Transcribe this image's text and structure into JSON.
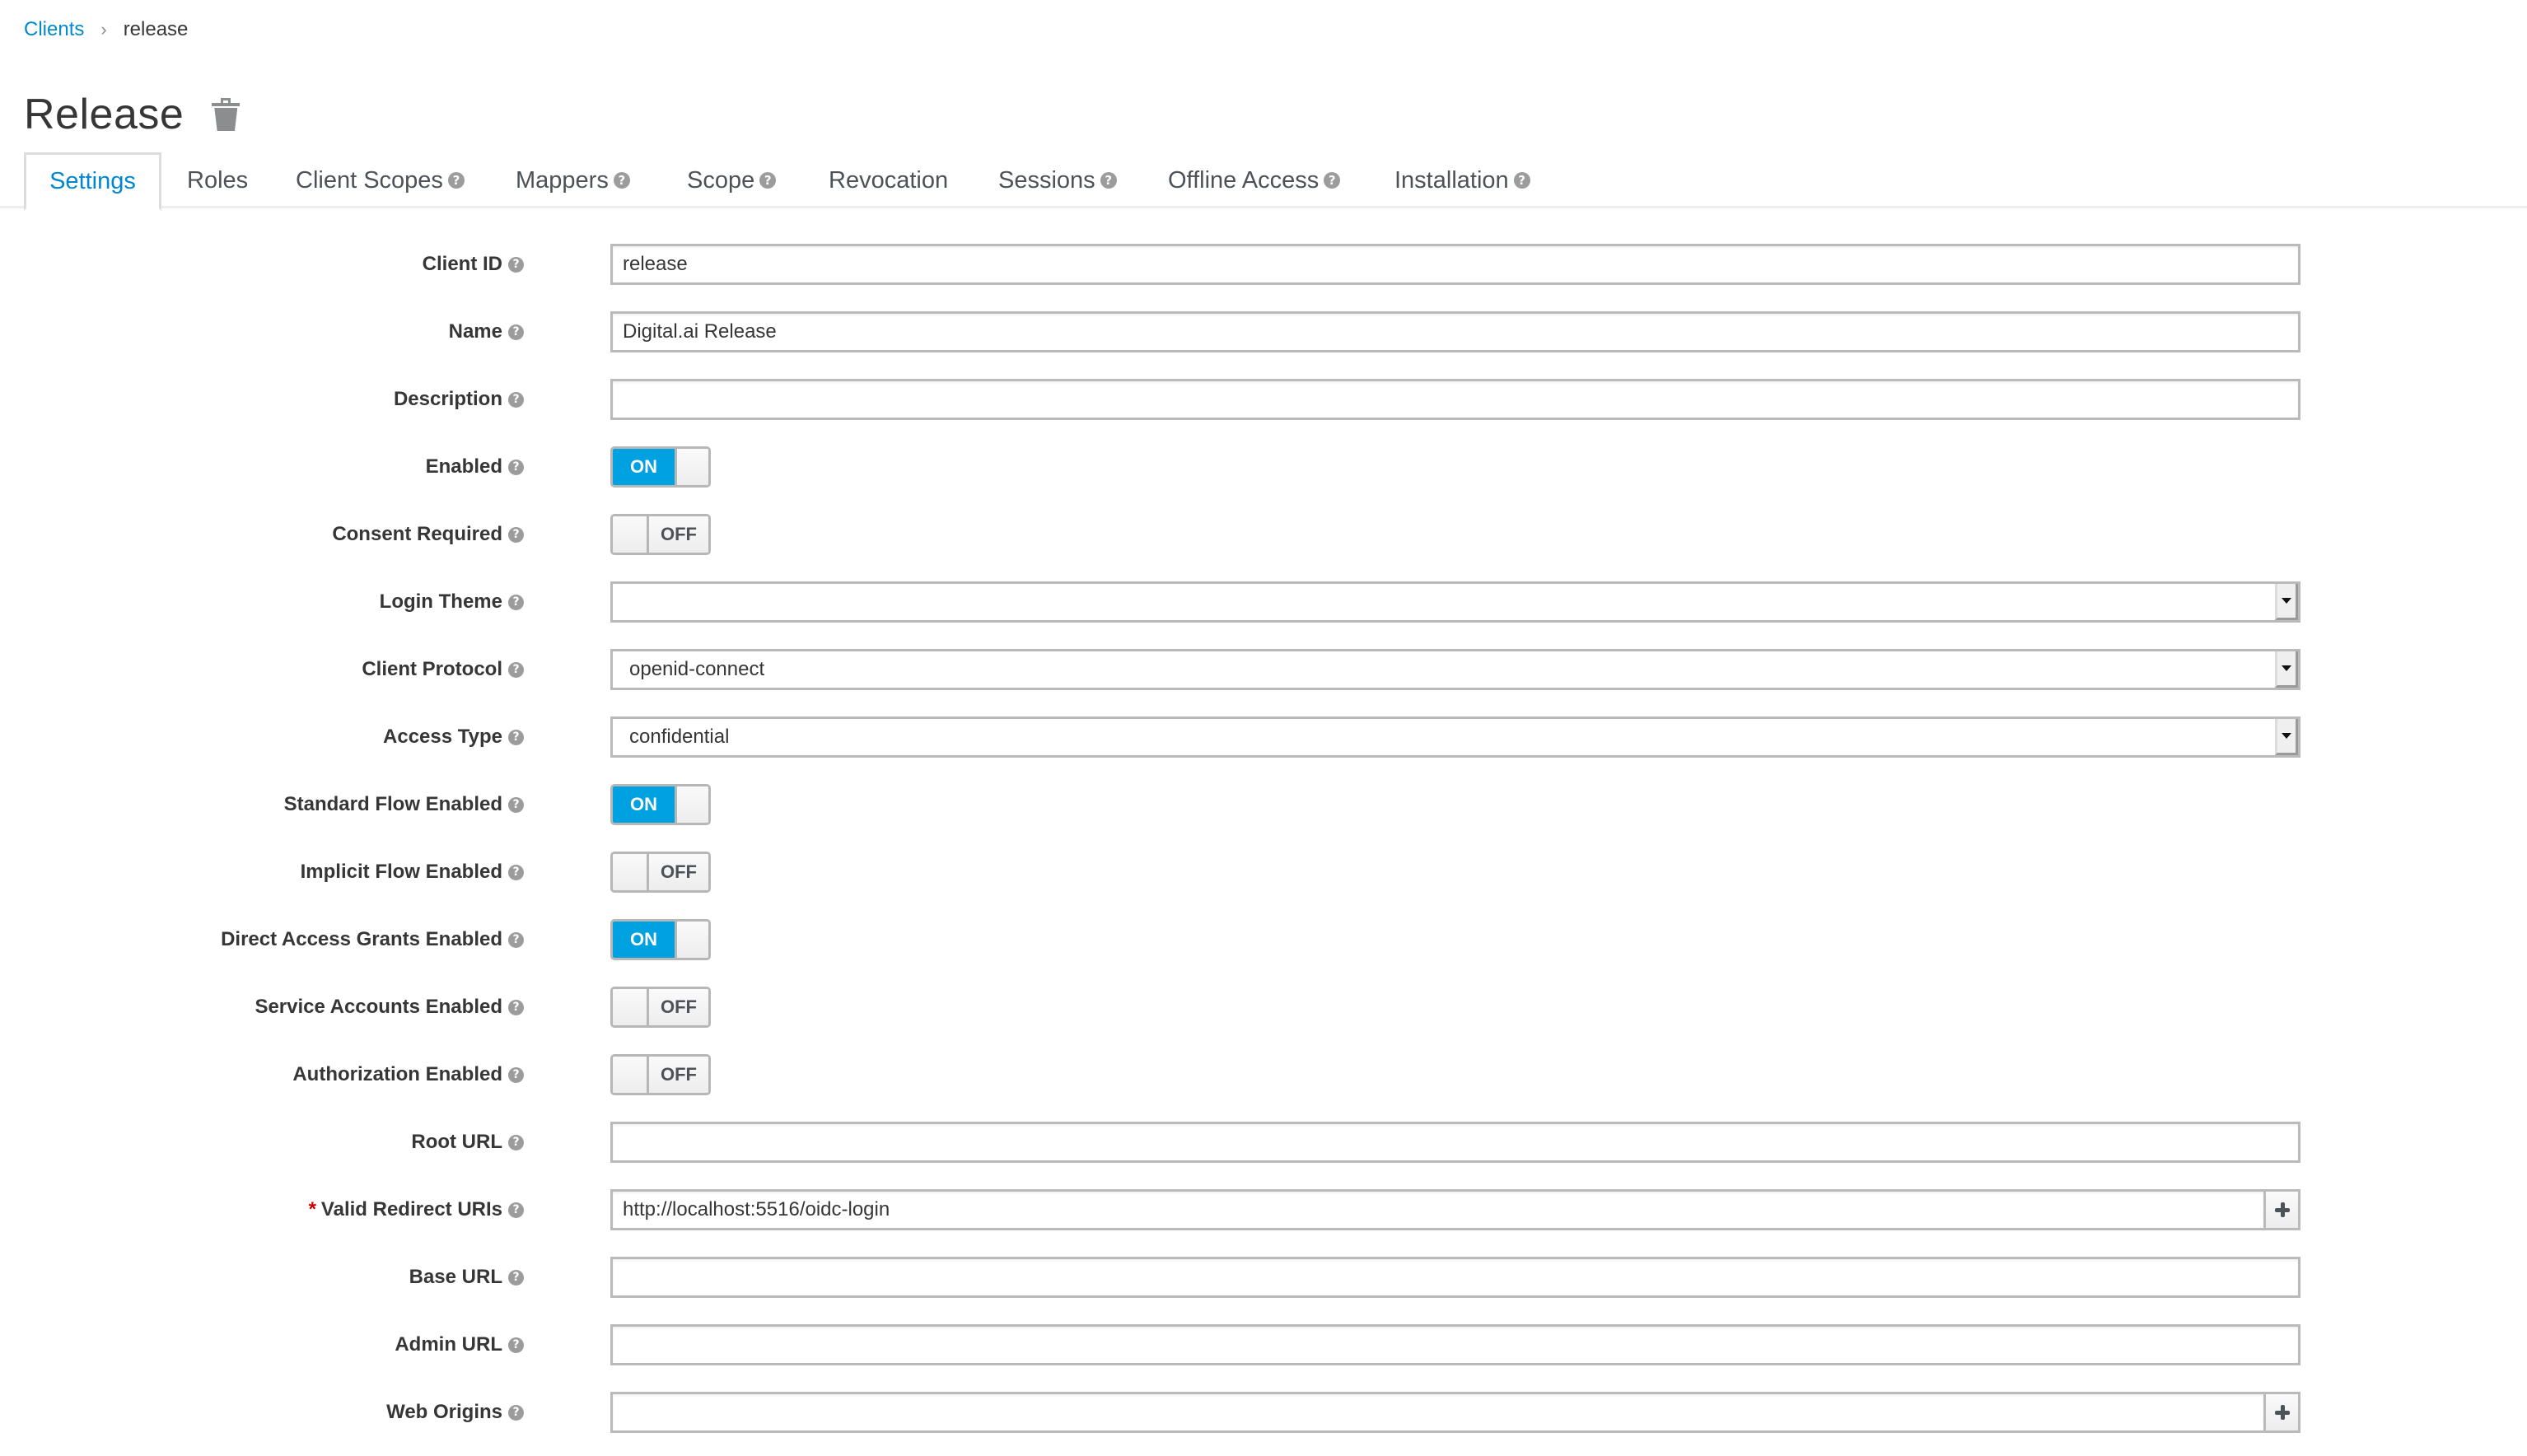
{
  "breadcrumb": {
    "parent": "Clients",
    "separator": "›",
    "current": "release"
  },
  "page": {
    "title": "Release",
    "delete_icon": "trash-icon"
  },
  "tabs": [
    {
      "label": "Settings",
      "help": false,
      "active": true
    },
    {
      "label": "Roles",
      "help": false
    },
    {
      "label": "Client Scopes",
      "help": true
    },
    {
      "label": "Mappers",
      "help": true
    },
    {
      "label": "Scope",
      "help": true
    },
    {
      "label": "Revocation",
      "help": false
    },
    {
      "label": "Sessions",
      "help": true
    },
    {
      "label": "Offline Access",
      "help": true
    },
    {
      "label": "Installation",
      "help": true
    }
  ],
  "help_glyph": "?",
  "required_mark": "*",
  "form": {
    "client_id": {
      "label": "Client ID",
      "value": "release"
    },
    "name": {
      "label": "Name",
      "value": "Digital.ai Release"
    },
    "description": {
      "label": "Description",
      "value": ""
    },
    "enabled": {
      "label": "Enabled",
      "state": "ON"
    },
    "consent_required": {
      "label": "Consent Required",
      "state": "OFF"
    },
    "login_theme": {
      "label": "Login Theme",
      "value": ""
    },
    "client_protocol": {
      "label": "Client Protocol",
      "value": "openid-connect"
    },
    "access_type": {
      "label": "Access Type",
      "value": "confidential"
    },
    "standard_flow": {
      "label": "Standard Flow Enabled",
      "state": "ON"
    },
    "implicit_flow": {
      "label": "Implicit Flow Enabled",
      "state": "OFF"
    },
    "direct_access": {
      "label": "Direct Access Grants Enabled",
      "state": "ON"
    },
    "service_accounts": {
      "label": "Service Accounts Enabled",
      "state": "OFF"
    },
    "authorization": {
      "label": "Authorization Enabled",
      "state": "OFF"
    },
    "root_url": {
      "label": "Root URL",
      "value": ""
    },
    "redirect_uris": {
      "label": "Valid Redirect URIs",
      "value": "http://localhost:5516/oidc-login",
      "required": true
    },
    "base_url": {
      "label": "Base URL",
      "value": ""
    },
    "admin_url": {
      "label": "Admin URL",
      "value": ""
    },
    "web_origins": {
      "label": "Web Origins",
      "value": ""
    }
  },
  "colors": {
    "link": "#0088ce",
    "toggle_on": "#00a1e1",
    "required": "#cc0000",
    "help_icon": "#9c9c9c"
  }
}
